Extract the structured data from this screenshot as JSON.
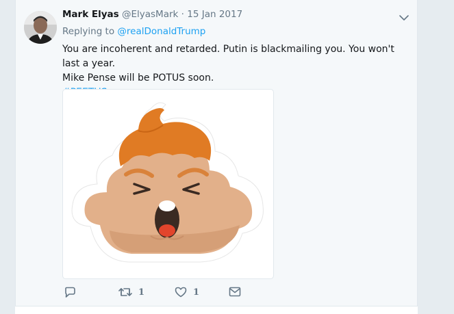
{
  "tweet": {
    "author_name": "Mark Elyas",
    "author_handle": "@ElyasMark",
    "separator": "·",
    "date": "15 Jan 2017",
    "replying_prefix": "Replying to",
    "replying_to": "@realDonaldTrump",
    "text_line1": "You are incoherent and retarded. Putin is blackmailing you. You won't last a year.",
    "text_line2": "Mike Pense will be POTUS soon.",
    "hashtag": "#PEETUS",
    "media_description": "Poop emoji with orange hair",
    "actions": {
      "reply_icon": "reply-icon",
      "retweet_icon": "retweet-icon",
      "retweet_count": "1",
      "like_icon": "heart-icon",
      "like_count": "1",
      "dm_icon": "envelope-icon"
    }
  },
  "colors": {
    "accent": "#1da1f2",
    "muted": "#657786",
    "hair": "#e07b24",
    "poop": "#e2b08a"
  }
}
